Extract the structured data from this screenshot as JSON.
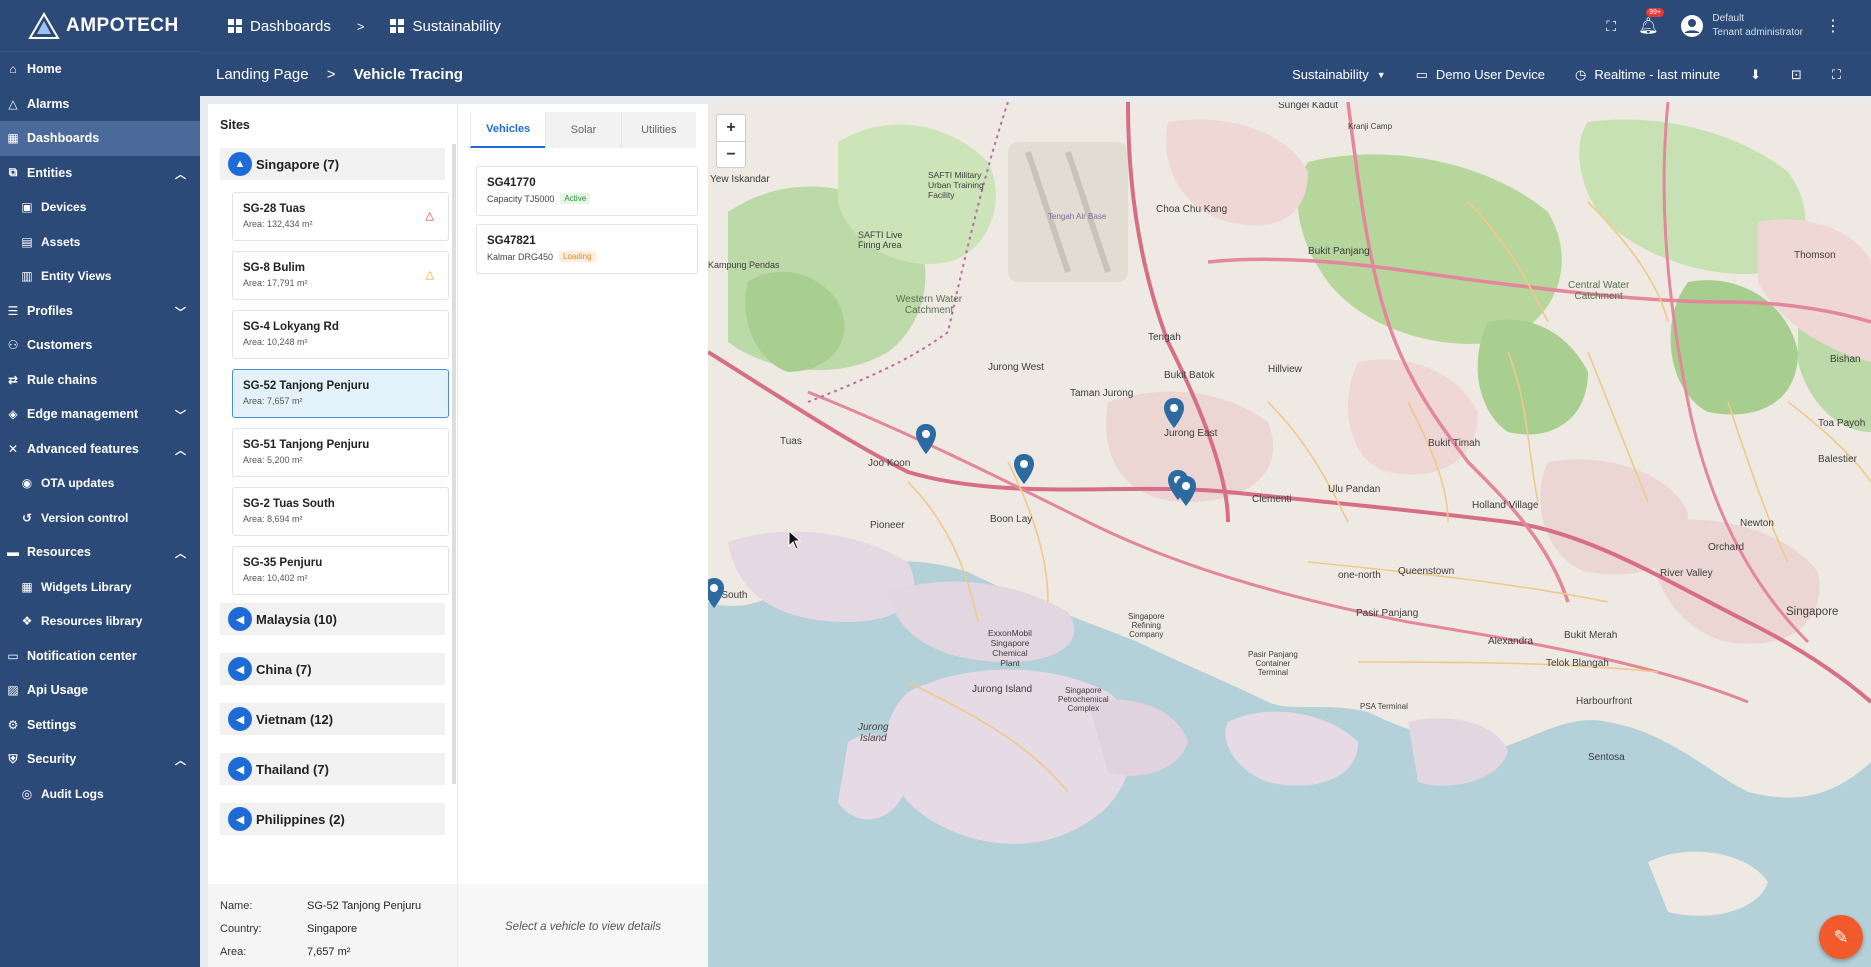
{
  "app": {
    "name": "AMPOTECH"
  },
  "sidebar": {
    "items": [
      {
        "label": "Home",
        "icon": "home-icon"
      },
      {
        "label": "Alarms",
        "icon": "alarm-icon"
      },
      {
        "label": "Dashboards",
        "icon": "dashboard-icon"
      },
      {
        "label": "Entities",
        "icon": "entities-icon"
      },
      {
        "label": "Devices",
        "icon": "device-icon"
      },
      {
        "label": "Assets",
        "icon": "asset-icon"
      },
      {
        "label": "Entity Views",
        "icon": "entity-view-icon"
      },
      {
        "label": "Profiles",
        "icon": "profiles-icon"
      },
      {
        "label": "Customers",
        "icon": "customers-icon"
      },
      {
        "label": "Rule chains",
        "icon": "rule-chain-icon"
      },
      {
        "label": "Edge management",
        "icon": "edge-icon"
      },
      {
        "label": "Advanced features",
        "icon": "tools-icon"
      },
      {
        "label": "OTA updates",
        "icon": "ota-icon"
      },
      {
        "label": "Version control",
        "icon": "history-icon"
      },
      {
        "label": "Resources",
        "icon": "folder-icon"
      },
      {
        "label": "Widgets Library",
        "icon": "widgets-icon"
      },
      {
        "label": "Resources library",
        "icon": "resources-icon"
      },
      {
        "label": "Notification center",
        "icon": "notification-icon"
      },
      {
        "label": "Api Usage",
        "icon": "api-icon"
      },
      {
        "label": "Settings",
        "icon": "settings-icon"
      },
      {
        "label": "Security",
        "icon": "security-icon"
      },
      {
        "label": "Audit Logs",
        "icon": "audit-icon"
      }
    ]
  },
  "topbar": {
    "crumb1": "Dashboards",
    "crumb_sep": ">",
    "crumb2": "Sustainability",
    "notif_count": "99+",
    "user_name": "Default",
    "user_role": "Tenant administrator"
  },
  "subbar": {
    "crumb1": "Landing Page",
    "sep": ">",
    "crumb2": "Vehicle Tracing",
    "dashboard_select": "Sustainability",
    "device": "Demo User Device",
    "timewindow": "Realtime - last minute"
  },
  "sites": {
    "title": "Sites",
    "groups": [
      {
        "label": "Singapore (7)"
      },
      {
        "label": "Malaysia (10)"
      },
      {
        "label": "China (7)"
      },
      {
        "label": "Vietnam (12)"
      },
      {
        "label": "Thailand (7)"
      },
      {
        "label": "Philippines (2)"
      }
    ],
    "cards": [
      {
        "name": "SG-28 Tuas",
        "area": "Area: 132,434 m²",
        "warn": "red"
      },
      {
        "name": "SG-8 Bulim",
        "area": "Area: 17,791 m²",
        "warn": "orange"
      },
      {
        "name": "SG-4 Lokyang Rd",
        "area": "Area: 10,248 m²"
      },
      {
        "name": "SG-52 Tanjong Penjuru",
        "area": "Area: 7,657 m²"
      },
      {
        "name": "SG-51 Tanjong Penjuru",
        "area": "Area: 5,200 m²"
      },
      {
        "name": "SG-2 Tuas South",
        "area": "Area: 8,694 m²"
      },
      {
        "name": "SG-35 Penjuru",
        "area": "Area: 10,402 m²"
      }
    ],
    "info": {
      "name_k": "Name:",
      "name_v": "SG-52 Tanjong Penjuru",
      "country_k": "Country:",
      "country_v": "Singapore",
      "area_k": "Area:",
      "area_v": "7,657 m²"
    }
  },
  "vehicles": {
    "tabs": [
      "Vehicles",
      "Solar",
      "Utilities"
    ],
    "items": [
      {
        "id": "SG41770",
        "capacity": "Capacity TJ5000",
        "status": "Active"
      },
      {
        "id": "SG47821",
        "capacity": "Kalmar DRG450",
        "status": "Loading"
      }
    ],
    "footer": "Select a vehicle to view details"
  },
  "map": {
    "zoom_in": "+",
    "zoom_out": "−",
    "labels": {
      "sungei_kadut": "Sungei Kadut",
      "tengah_air_base": "Tengah Air Base",
      "jurong_west": "Jurong West",
      "taman_jurong": "Taman Jurong",
      "jurong_east": "Jurong East",
      "tuas": "Tuas",
      "joo_koon": "Joo Koon",
      "pioneer": "Pioneer",
      "boon_lay": "Boon Lay",
      "tuas_south": "as South",
      "jurong_island": "Jurong Island",
      "jurong_island_it": "Jurong\nIsland",
      "choa_chu_kang": "Choa Chu Kang",
      "bukit_panjang": "Bukit Panjang",
      "bukit_batok": "Bukit Batok",
      "hillview": "Hillview",
      "western_water": "Western Water\nCatchment",
      "central_water": "Central Water\nCatchment",
      "clementi": "Clementi",
      "bukit_timah": "Bukit Timah",
      "ulu_pandan": "Ulu Pandan",
      "holland_village": "Holland Village",
      "queenstown": "Queenstown",
      "one_north": "one-north",
      "pasir_panjang": "Pasir Panjang",
      "alexandra": "Alexandra",
      "bukit_merah": "Bukit Merah",
      "telok_blangah": "Telok Blangah",
      "singapore": "Singapore",
      "harbourfront": "Harbourfront",
      "sentosa": "Sentosa",
      "river_valley": "River Valley",
      "orchard": "Orchard",
      "newton": "Newton",
      "toa_payoh": "Toa Payoh",
      "balestier": "Balestier",
      "bishan": "Bishan",
      "thomson": "Thomson",
      "kranji_camp": "Kranji Camp",
      "safti": "SAFTI Live\nFiring Area",
      "urban_training": "SAFTI Military\nUrban Training\nFacility",
      "tengah": "Tengah",
      "exxonmobil": "ExxonMobil\nSingapore\nChemical\nPlant",
      "sg_refining": "Singapore\nRefining\nCompany",
      "sg_petro": "Singapore\nPetrochemical\nComplex",
      "pasir_panjang_terminal": "Pasir Panjang\nContainer\nTerminal",
      "psa_terminal": "PSA Terminal",
      "yishun_west": "Yew Iskandar",
      "kampung_pendas": "Kampung Pendas",
      "jurong_island_road": "Jurong Island"
    }
  }
}
